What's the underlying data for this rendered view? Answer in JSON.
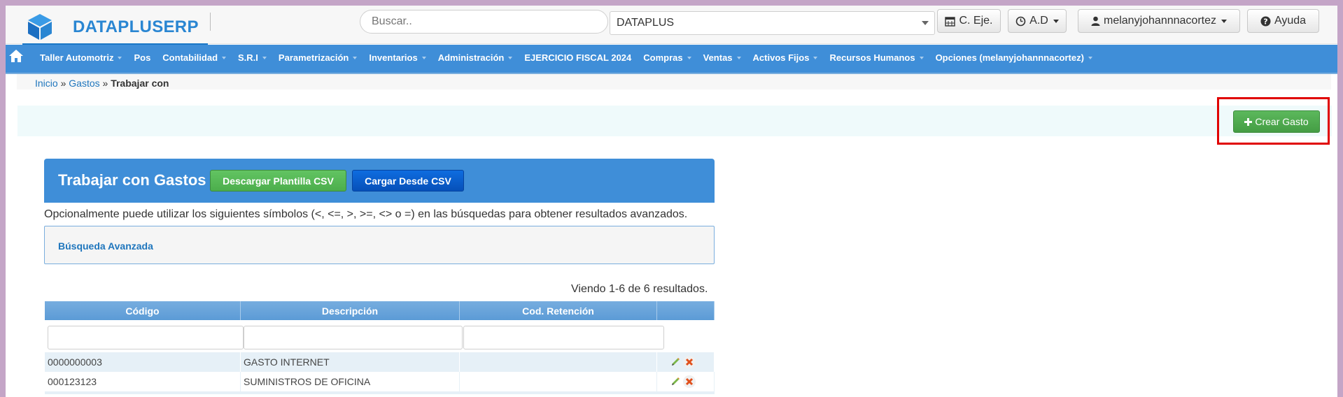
{
  "header": {
    "brand": "DATAPLUSERP",
    "search_placeholder": "Buscar..",
    "company": "DATAPLUS",
    "buttons": {
      "ejercicio": "C. Eje.",
      "ad": "A.D",
      "user": "melanyjohannnacortez",
      "help": "Ayuda"
    }
  },
  "nav": {
    "items": [
      {
        "label": "Taller Automotriz",
        "dropdown": true
      },
      {
        "label": "Pos",
        "dropdown": false
      },
      {
        "label": "Contabilidad",
        "dropdown": true
      },
      {
        "label": "S.R.I",
        "dropdown": true
      },
      {
        "label": "Parametrización",
        "dropdown": true
      },
      {
        "label": "Inventarios",
        "dropdown": true
      },
      {
        "label": "Administración",
        "dropdown": true
      },
      {
        "label": "EJERCICIO FISCAL 2024",
        "dropdown": false
      },
      {
        "label": "Compras",
        "dropdown": true
      },
      {
        "label": "Ventas",
        "dropdown": true
      },
      {
        "label": "Activos Fijos",
        "dropdown": true
      },
      {
        "label": "Recursos Humanos",
        "dropdown": true
      },
      {
        "label": "Opciones (melanyjohannnacortez)",
        "dropdown": true
      }
    ]
  },
  "breadcrumb": {
    "home": "Inicio",
    "sep1": "»",
    "section": "Gastos",
    "sep2": "»",
    "current": "Trabajar con"
  },
  "actions": {
    "create": "Crear Gasto"
  },
  "panel": {
    "title": "Trabajar con Gastos",
    "download_csv": "Descargar Plantilla CSV",
    "load_csv": "Cargar Desde CSV",
    "hint": "Opcionalmente puede utilizar los siguientes símbolos (<, <=, >, >=, <> o =) en las búsquedas para obtener resultados avanzados.",
    "advanced_search": "Búsqueda Avanzada",
    "summary": "Viendo 1-6 de 6 resultados."
  },
  "grid": {
    "columns": [
      "Código",
      "Descripción",
      "Cod. Retención",
      ""
    ],
    "filters": [
      "",
      "",
      ""
    ],
    "rows": [
      {
        "codigo": "0000000003",
        "descripcion": "GASTO INTERNET",
        "retencion": ""
      },
      {
        "codigo": "000123123",
        "descripcion": "SUMINISTROS DE OFICINA",
        "retencion": ""
      }
    ]
  },
  "colors": {
    "brand": "#2a86d2",
    "navbar": "#3f8ed8",
    "success": "#5cb85c",
    "primary": "#0e6de0",
    "highlight": "#e00000"
  }
}
